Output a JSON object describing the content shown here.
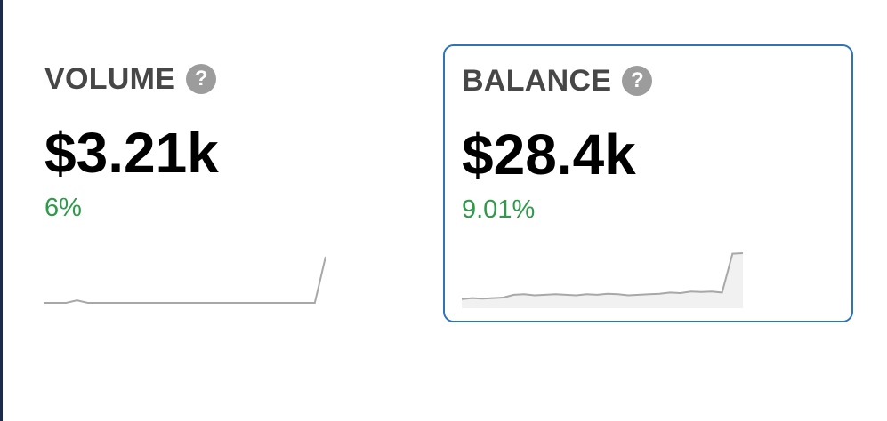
{
  "metrics": [
    {
      "title": "VOLUME",
      "help_icon": "question-circle-icon",
      "value": "$3.21k",
      "change": "6%",
      "trend": [
        0,
        0,
        0,
        0.5,
        0,
        0,
        0,
        0,
        0,
        0,
        0,
        0,
        0,
        0,
        0,
        0,
        0,
        0,
        0,
        0,
        0,
        0,
        0,
        0,
        0,
        0,
        9
      ]
    },
    {
      "title": "BALANCE",
      "help_icon": "question-circle-icon",
      "value": "$28.4k",
      "change": "9.01%",
      "trend": [
        1,
        1.2,
        1.1,
        1.2,
        1.3,
        1.8,
        1.9,
        1.7,
        1.8,
        1.9,
        1.8,
        1.7,
        1.9,
        1.8,
        2.0,
        1.9,
        1.7,
        1.8,
        1.9,
        2.0,
        2.2,
        2.1,
        2.4,
        2.3,
        2.4,
        2.2,
        9.3,
        9.4
      ]
    }
  ],
  "colors": {
    "positive": "#2f9a4a",
    "selected_border": "#2f73b8",
    "sparkline": "#a8a8a8"
  }
}
